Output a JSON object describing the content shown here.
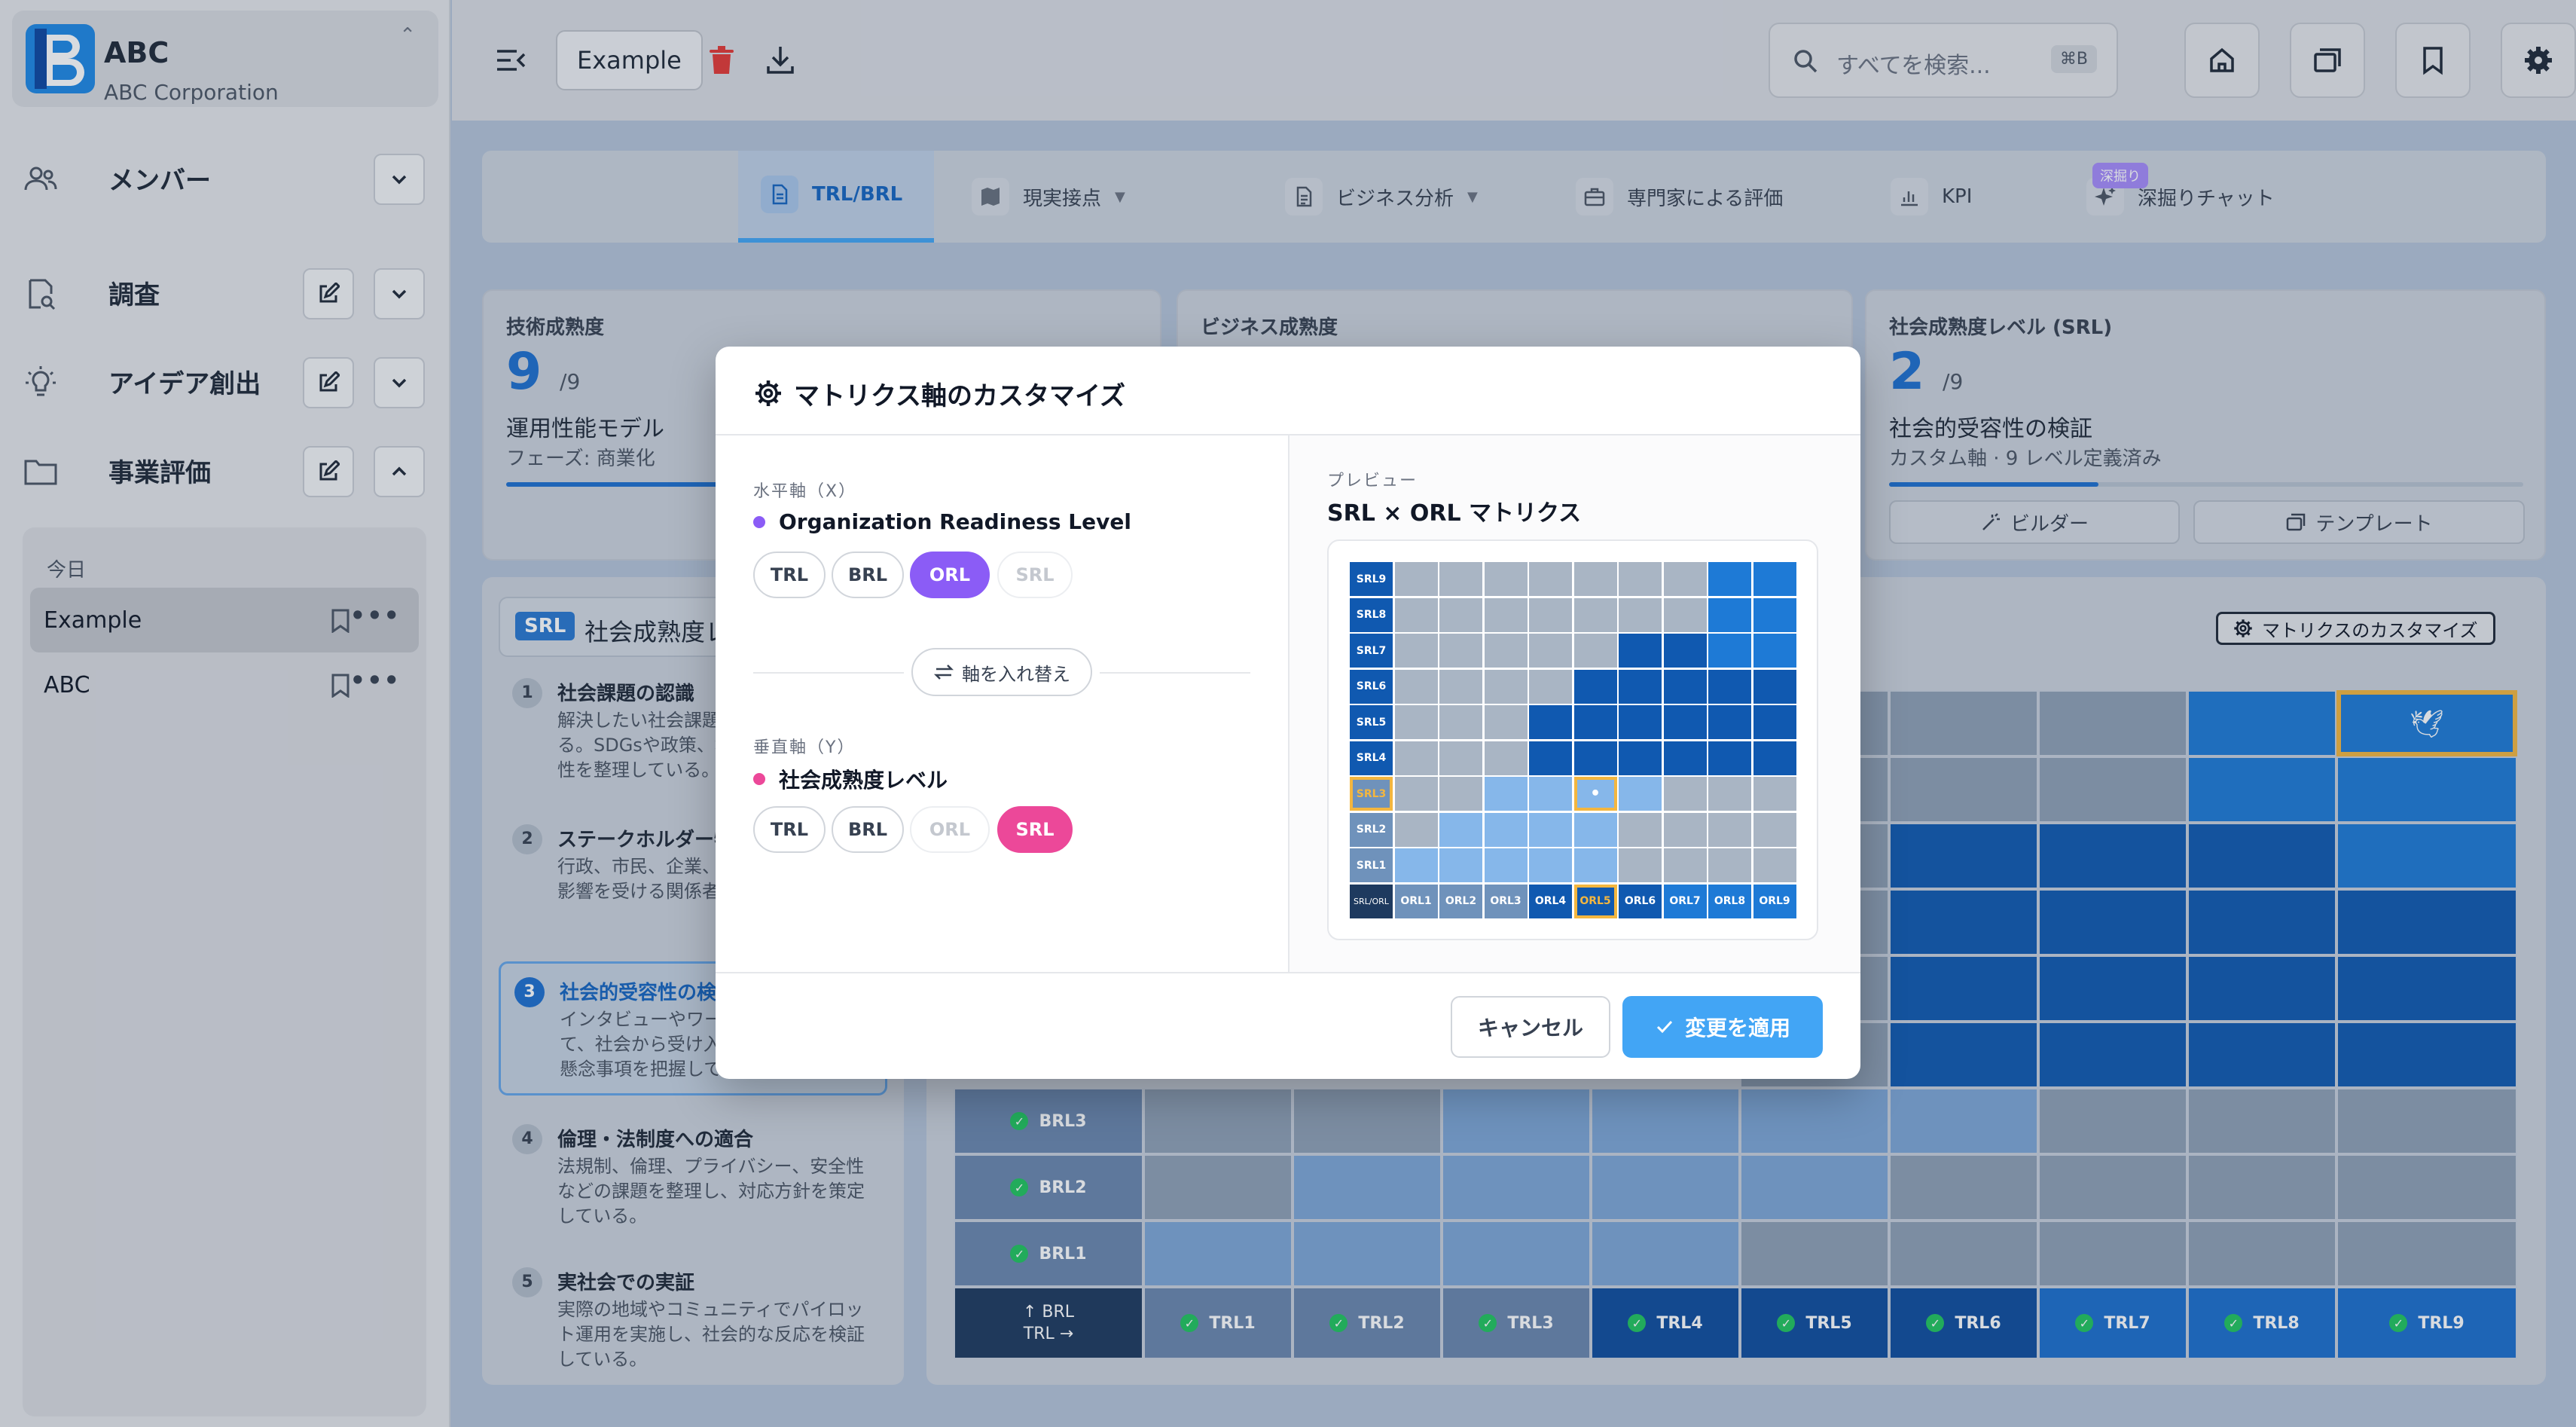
{
  "org": {
    "name": "ABC",
    "subtitle": "ABC Corporation",
    "logo_letter": "B"
  },
  "sidebar": {
    "nav": [
      {
        "label": "メンバー",
        "icon": "users-icon",
        "expanded": false,
        "has_edit": false
      },
      {
        "label": "調査",
        "icon": "search-document-icon",
        "expanded": false,
        "has_edit": true
      },
      {
        "label": "アイデア創出",
        "icon": "lightbulb-icon",
        "expanded": false,
        "has_edit": true
      },
      {
        "label": "事業評価",
        "icon": "folder-icon",
        "expanded": true,
        "has_edit": true
      }
    ],
    "history_section": "今日",
    "history": [
      {
        "label": "Example",
        "active": true
      },
      {
        "label": "ABC",
        "active": false
      }
    ]
  },
  "topbar": {
    "project_title": "Example",
    "search_placeholder": "すべてを検索...",
    "search_shortcut": "⌘B"
  },
  "tabs": [
    {
      "label": "TRL/BRL",
      "icon": "document-icon",
      "active": true,
      "dropdown": false
    },
    {
      "label": "現実接点",
      "icon": "map-icon",
      "active": false,
      "dropdown": true
    },
    {
      "label": "ビジネス分析",
      "icon": "report-icon",
      "active": false,
      "dropdown": true
    },
    {
      "label": "専門家による評価",
      "icon": "briefcase-icon",
      "active": false,
      "dropdown": false
    },
    {
      "label": "KPI",
      "icon": "chart-icon",
      "active": false,
      "dropdown": false
    },
    {
      "label": "深掘りチャット",
      "icon": "sparkle-icon",
      "active": false,
      "dropdown": false,
      "badge": "深掘り"
    }
  ],
  "metrics": {
    "tech": {
      "title": "技術成熟度",
      "score": "9",
      "denominator": "/9",
      "name": "運用性能モデル",
      "sub": "フェーズ: 商業化",
      "progress": 1.0
    },
    "business": {
      "title": "ビジネス成熟度"
    },
    "social": {
      "title": "社会成熟度レベル (SRL)",
      "score": "2",
      "denominator": "/9",
      "name": "社会的受容性の検証",
      "sub": "カスタム軸 · 9 レベル定義済み",
      "progress": 0.33,
      "builder_label": "ビルダー",
      "template_label": "テンプレート"
    }
  },
  "levels_panel": {
    "chip": "SRL",
    "heading": "社会成熟度レベル",
    "items": [
      {
        "num": "1",
        "title": "社会課題の認識",
        "desc": "解決したい社会課題が明確になっている。SDGsや政策、地域課題との関連性を整理している。",
        "active": false
      },
      {
        "num": "2",
        "title": "ステークホルダー特定",
        "desc": "行政、市民、企業、NPOなど、社会的影響を受ける関係者を特定している。",
        "active": false
      },
      {
        "num": "3",
        "title": "社会的受容性の検証",
        "desc": "インタビューやワークショップを通じて、社会から受け入れられる可能性や懸念事項を把握している。",
        "active": true
      },
      {
        "num": "4",
        "title": "倫理・法制度への適合",
        "desc": "法規制、倫理、プライバシー、安全性などの課題を整理し、対応方針を策定している。",
        "active": false
      },
      {
        "num": "5",
        "title": "実社会での実証",
        "desc": "実際の地域やコミュニティでパイロット運用を実施し、社会的な反応を検証している。",
        "active": false
      }
    ]
  },
  "matrix": {
    "customize_label": "マトリクスのカスタマイズ",
    "corner_top": "↑ BRL",
    "corner_bottom": "TRL →",
    "row_labels": [
      "BRL3",
      "BRL2",
      "BRL1"
    ],
    "col_labels": [
      "TRL1",
      "TRL2",
      "TRL3",
      "TRL4",
      "TRL5",
      "TRL6",
      "TRL7",
      "TRL8",
      "TRL9"
    ],
    "col_colors": [
      "#6b87ae",
      "#6b87ae",
      "#6b87ae",
      "#0f4e9e",
      "#0f4e9e",
      "#0f4e9e",
      "#1d6fcd",
      "#1d6fcd",
      "#1d6fcd"
    ],
    "row_label_color": "#6b87ae",
    "corner_color": "#1e3a5f",
    "top_rows": [
      [
        "#8fa0b5",
        "#8fa0b5",
        "#8fa0b5",
        "#1e7ad6",
        "#1e7ad6"
      ],
      [
        "#8fa0b5",
        "#8fa0b5",
        "#8fa0b5",
        "#1e7ad6",
        "#1e7ad6"
      ],
      [
        "#8fa0b5",
        "#1059b0",
        "#1059b0",
        "#1059b0",
        "#1e7ad6"
      ],
      [
        "#8fa0b5",
        "#1059b0",
        "#1059b0",
        "#1059b0",
        "#1059b0"
      ],
      [
        "#8fa0b5",
        "#1059b0",
        "#1059b0",
        "#1059b0",
        "#1059b0"
      ],
      [
        "#8fa0b5",
        "#1059b0",
        "#1059b0",
        "#1059b0",
        "#1059b0"
      ]
    ],
    "bottom_rows": [
      [
        "#8fa0b5",
        "#8fa0b5",
        "#7ea6d6",
        "#7ea6d6",
        "#7ea6d6",
        "#7ea6d6",
        "#8fa0b5",
        "#8fa0b5",
        "#8fa0b5"
      ],
      [
        "#8fa0b5",
        "#7ea6d6",
        "#7ea6d6",
        "#7ea6d6",
        "#7ea6d6",
        "#8fa0b5",
        "#8fa0b5",
        "#8fa0b5",
        "#8fa0b5"
      ],
      [
        "#7ea6d6",
        "#7ea6d6",
        "#7ea6d6",
        "#7ea6d6",
        "#8fa0b5",
        "#8fa0b5",
        "#8fa0b5",
        "#8fa0b5",
        "#8fa0b5"
      ]
    ],
    "extra_col_rows": 1
  },
  "modal": {
    "title": "マトリクス軸のカスタマイズ",
    "horizontal": {
      "section": "水平軸（X）",
      "name": "Organization Readiness Level",
      "dot_color": "#8b5cf6",
      "options": [
        {
          "label": "TRL",
          "state": "normal"
        },
        {
          "label": "BRL",
          "state": "normal"
        },
        {
          "label": "ORL",
          "state": "selected"
        },
        {
          "label": "SRL",
          "state": "disabled"
        }
      ]
    },
    "swap_label": "軸を入れ替え",
    "vertical": {
      "section": "垂直軸（Y）",
      "name": "社会成熟度レベル",
      "dot_color": "#ec4899",
      "options": [
        {
          "label": "TRL",
          "state": "normal"
        },
        {
          "label": "BRL",
          "state": "normal"
        },
        {
          "label": "ORL",
          "state": "disabled"
        },
        {
          "label": "SRL",
          "state": "selected"
        }
      ]
    },
    "preview": {
      "section": "プレビュー",
      "title": "SRL × ORL マトリクス",
      "row_labels": [
        "SRL9",
        "SRL8",
        "SRL7",
        "SRL6",
        "SRL5",
        "SRL4",
        "SRL3",
        "SRL2",
        "SRL1"
      ],
      "col_labels": [
        "ORL1",
        "ORL2",
        "ORL3",
        "ORL4",
        "ORL5",
        "ORL6",
        "ORL7",
        "ORL8",
        "ORL9"
      ],
      "corner": "SRL/ORL",
      "highlight_row": "SRL3",
      "highlight_col": "ORL5",
      "colors": {
        "gray": "#a9b5c4",
        "light": "#86b7ea",
        "dark": "#1059b0",
        "bright": "#1e7ad6",
        "label_dark": "#1e3a5f",
        "label_light": "#6f92bb"
      },
      "grid": [
        [
          "g",
          "g",
          "g",
          "g",
          "g",
          "g",
          "g",
          "b",
          "b"
        ],
        [
          "g",
          "g",
          "g",
          "g",
          "g",
          "g",
          "g",
          "b",
          "b"
        ],
        [
          "g",
          "g",
          "g",
          "g",
          "g",
          "d",
          "d",
          "b",
          "b"
        ],
        [
          "g",
          "g",
          "g",
          "g",
          "d",
          "d",
          "d",
          "d",
          "d"
        ],
        [
          "g",
          "g",
          "g",
          "d",
          "d",
          "d",
          "d",
          "d",
          "d"
        ],
        [
          "g",
          "g",
          "g",
          "d",
          "d",
          "d",
          "d",
          "d",
          "d"
        ],
        [
          "g",
          "g",
          "l",
          "l",
          "s",
          "l",
          "g",
          "g",
          "g"
        ],
        [
          "g",
          "l",
          "l",
          "l",
          "l",
          "g",
          "g",
          "g",
          "g"
        ],
        [
          "l",
          "l",
          "l",
          "l",
          "l",
          "g",
          "g",
          "g",
          "g"
        ]
      ]
    },
    "cancel_label": "キャンセル",
    "apply_label": "変更を適用"
  }
}
